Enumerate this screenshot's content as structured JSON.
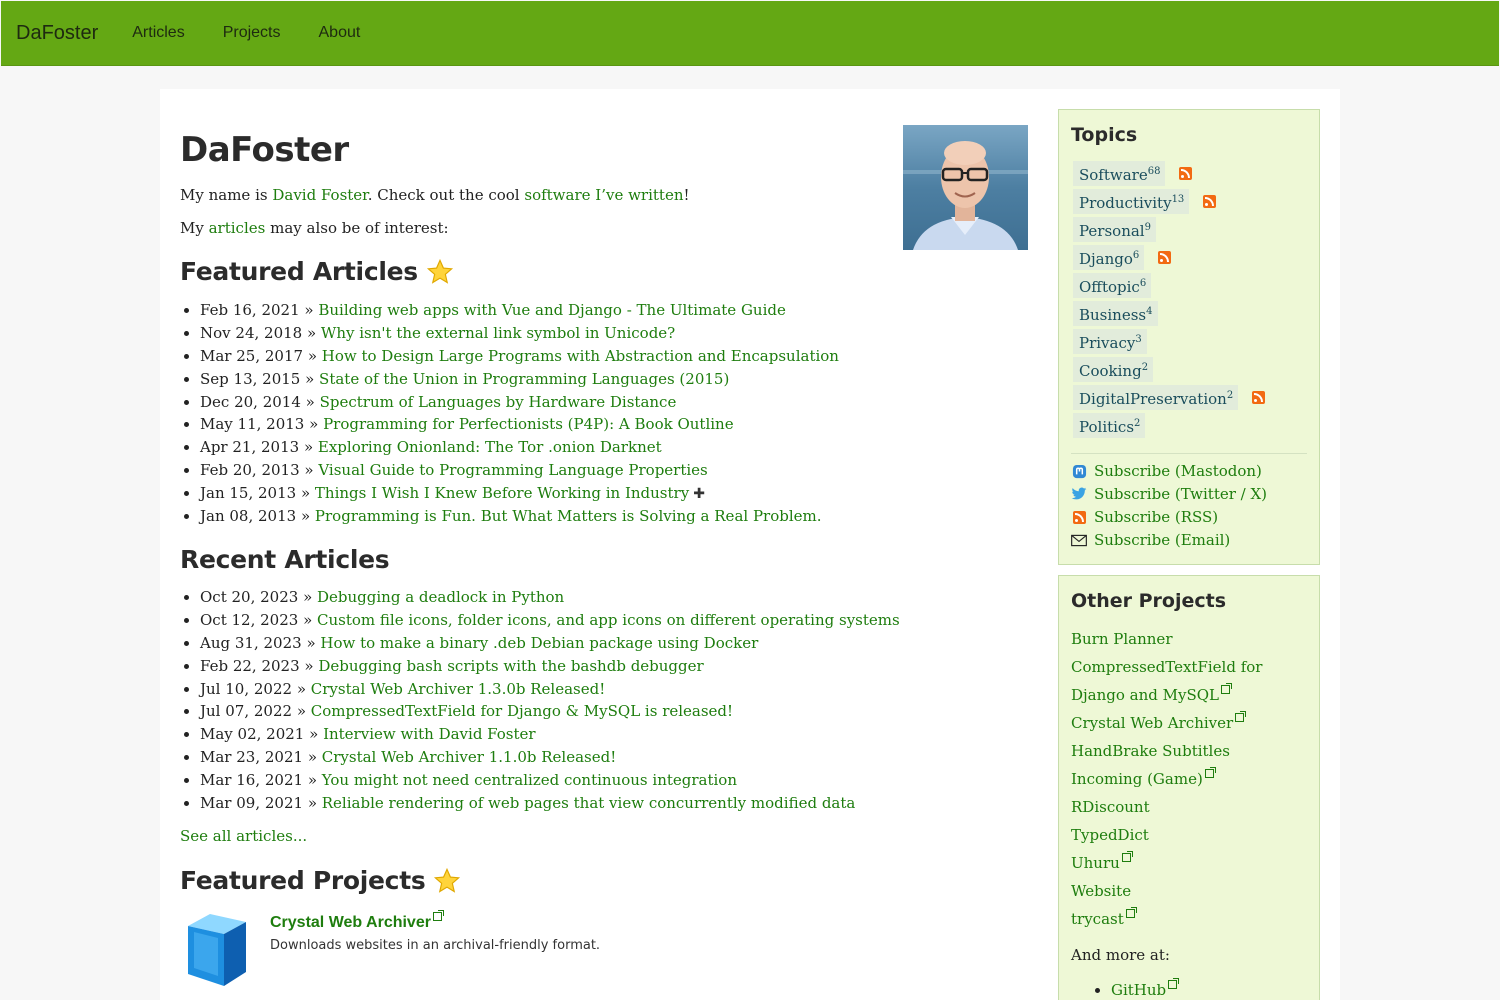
{
  "nav": {
    "brand": "DaFoster",
    "links": [
      "Articles",
      "Projects",
      "About"
    ]
  },
  "page": {
    "title": "DaFoster",
    "intro1_prefix": "My name is ",
    "intro1_name": "David Foster",
    "intro1_mid": ". Check out the cool ",
    "intro1_link": "software I’ve written",
    "intro1_suffix": "!",
    "intro2_prefix": "My ",
    "intro2_link": "articles",
    "intro2_suffix": " may also be of interest:"
  },
  "featured_articles": {
    "heading": "Featured Articles",
    "items": [
      {
        "date": "Feb 16, 2021",
        "title": "Building web apps with Vue and Django - The Ultimate Guide"
      },
      {
        "date": "Nov 24, 2018",
        "title": "Why isn't the external link symbol in Unicode?"
      },
      {
        "date": "Mar 25, 2017",
        "title": "How to Design Large Programs with Abstraction and Encapsulation"
      },
      {
        "date": "Sep 13, 2015",
        "title": "State of the Union in Programming Languages (2015)"
      },
      {
        "date": "Dec 20, 2014",
        "title": "Spectrum of Languages by Hardware Distance"
      },
      {
        "date": "May 11, 2013",
        "title": "Programming for Perfectionists (P4P): A Book Outline"
      },
      {
        "date": "Apr 21, 2013",
        "title": "Exploring Onionland: The Tor .onion Darknet"
      },
      {
        "date": "Feb 20, 2013",
        "title": "Visual Guide to Programming Language Properties"
      },
      {
        "date": "Jan 15, 2013",
        "title": "Things I Wish I Knew Before Working in Industry"
      },
      {
        "date": "Jan 08, 2013",
        "title": "Programming is Fun. But What Matters is Solving a Real Problem."
      }
    ],
    "separator": " » ",
    "plus_glyph": "✚"
  },
  "recent_articles": {
    "heading": "Recent Articles",
    "items": [
      {
        "date": "Oct 20, 2023",
        "title": "Debugging a deadlock in Python"
      },
      {
        "date": "Oct 12, 2023",
        "title": "Custom file icons, folder icons, and app icons on different operating systems"
      },
      {
        "date": "Aug 31, 2023",
        "title": "How to make a binary .deb Debian package using Docker"
      },
      {
        "date": "Feb 22, 2023",
        "title": "Debugging bash scripts with the bashdb debugger"
      },
      {
        "date": "Jul 10, 2022",
        "title": "Crystal Web Archiver 1.3.0b Released!"
      },
      {
        "date": "Jul 07, 2022",
        "title": "CompressedTextField for Django & MySQL is released!"
      },
      {
        "date": "May 02, 2021",
        "title": "Interview with David Foster"
      },
      {
        "date": "Mar 23, 2021",
        "title": "Crystal Web Archiver 1.1.0b Released!"
      },
      {
        "date": "Mar 16, 2021",
        "title": "You might not need centralized continuous integration"
      },
      {
        "date": "Mar 09, 2021",
        "title": "Reliable rendering of web pages that view concurrently modified data"
      }
    ],
    "see_all": "See all articles..."
  },
  "featured_projects": {
    "heading": "Featured Projects",
    "project_title": "Crystal Web Archiver",
    "project_desc": "Downloads websites in an archival-friendly format."
  },
  "topics": {
    "heading": "Topics",
    "items": [
      {
        "name": "Software",
        "count": "68",
        "rss": true
      },
      {
        "name": "Productivity",
        "count": "13",
        "rss": true
      },
      {
        "name": "Personal",
        "count": "9",
        "rss": false
      },
      {
        "name": "Django",
        "count": "6",
        "rss": true
      },
      {
        "name": "Offtopic",
        "count": "6",
        "rss": false
      },
      {
        "name": "Business",
        "count": "4",
        "rss": false
      },
      {
        "name": "Privacy",
        "count": "3",
        "rss": false
      },
      {
        "name": "Cooking",
        "count": "2",
        "rss": false
      },
      {
        "name": "DigitalPreservation",
        "count": "2",
        "rss": true
      },
      {
        "name": "Politics",
        "count": "2",
        "rss": false
      }
    ],
    "subscribe": [
      {
        "label": "Subscribe (Mastodon)",
        "icon": "mastodon-icon"
      },
      {
        "label": "Subscribe (Twitter / X)",
        "icon": "twitter-icon"
      },
      {
        "label": "Subscribe (RSS)",
        "icon": "rss-icon"
      },
      {
        "label": "Subscribe (Email)",
        "icon": "email-icon"
      }
    ]
  },
  "other_projects": {
    "heading": "Other Projects",
    "items": [
      {
        "name": "Burn Planner",
        "external": false
      },
      {
        "name": "CompressedTextField for Django and MySQL",
        "external": true
      },
      {
        "name": "Crystal Web Archiver",
        "external": true
      },
      {
        "name": "HandBrake Subtitles",
        "external": false
      },
      {
        "name": "Incoming (Game)",
        "external": true
      },
      {
        "name": "RDiscount",
        "external": false
      },
      {
        "name": "TypedDict",
        "external": false
      },
      {
        "name": "Uhuru",
        "external": true
      },
      {
        "name": "Website",
        "external": false
      },
      {
        "name": "trycast",
        "external": true
      }
    ],
    "more_at": "And more at:",
    "more_links": [
      {
        "name": "GitHub",
        "external": true
      }
    ]
  },
  "colors": {
    "navbar": "#64a814",
    "link": "#1e7d0e",
    "sidebar_bg": "#eef8d6",
    "rss": "#f26a12"
  }
}
